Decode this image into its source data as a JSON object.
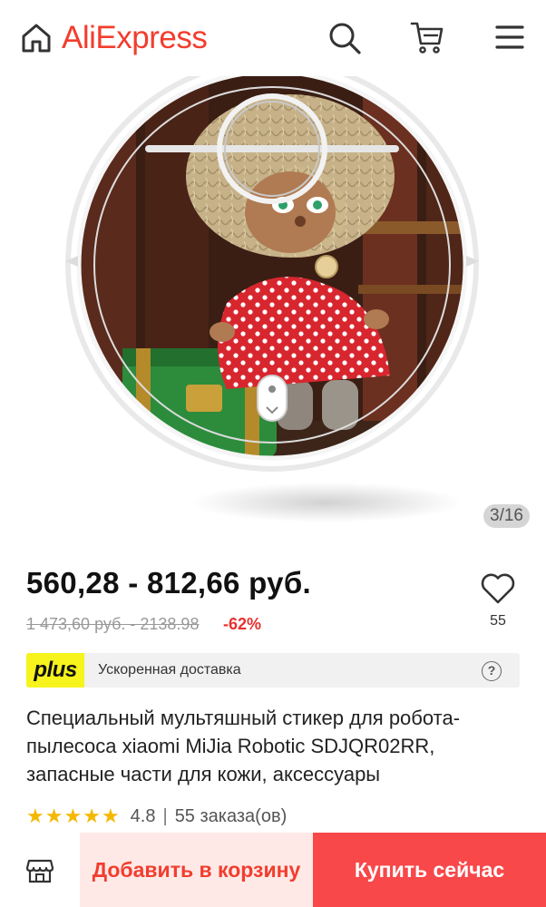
{
  "header": {
    "logo_text": "AliExpress",
    "brand_color": "#f23d2e",
    "icons": [
      "home-icon",
      "search-icon",
      "cart-icon",
      "menu-icon"
    ]
  },
  "gallery": {
    "counter": "3/16"
  },
  "product": {
    "price": "560,28 - 812,66 руб.",
    "old_price": "1 473,60 руб. - 2138.98",
    "discount": "-62%",
    "likes": "55",
    "title": "Специальный мультяшный стикер для робота-пылесоса xiaomi MiJia Robotic SDJQR02RR, запасные части для кожи, аксессуары",
    "rating": "4.8",
    "orders": "55 заказа(ов)",
    "stars_filled": 5
  },
  "plus": {
    "badge": "plus",
    "text": "Ускоренная доставка",
    "badge_color": "#f7f31c"
  },
  "actions": {
    "add_to_cart": "Добавить в корзину",
    "buy_now": "Купить сейчас",
    "buy_color": "#f8484a"
  }
}
